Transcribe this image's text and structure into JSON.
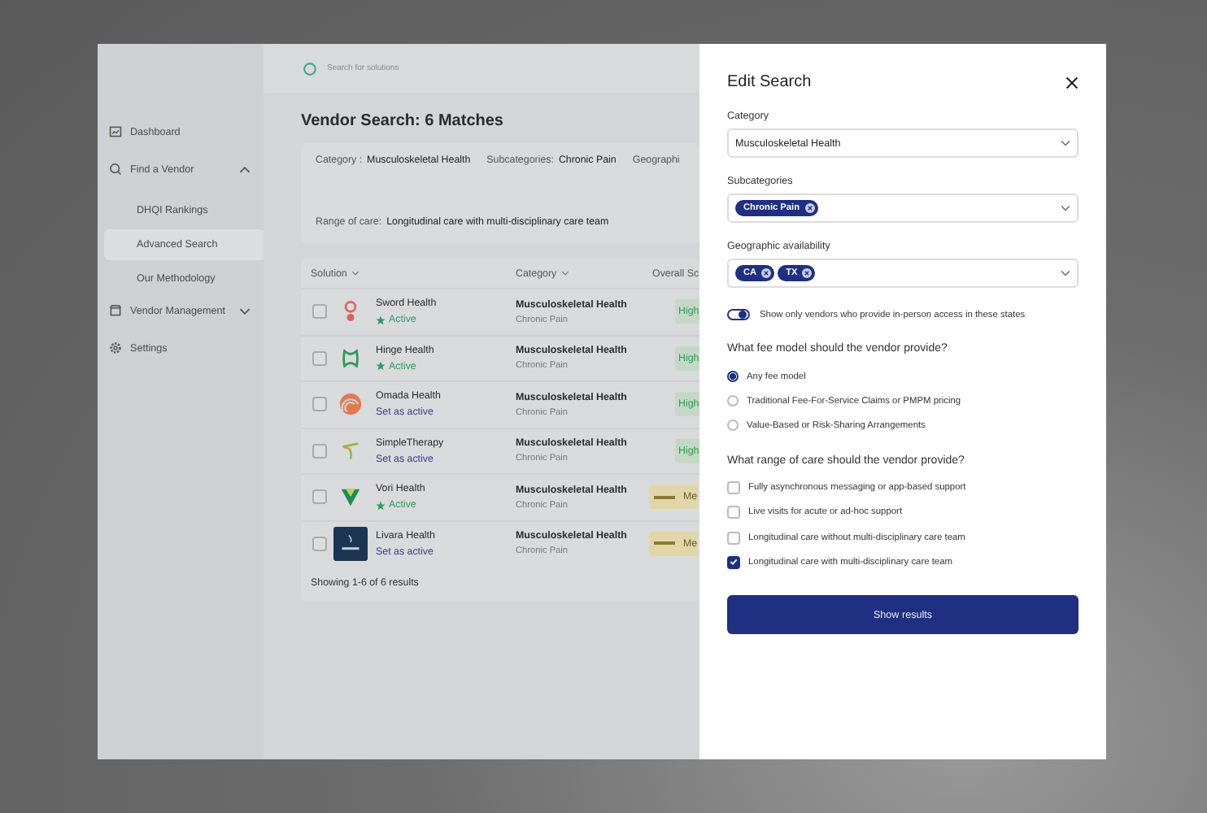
{
  "sidebar": {
    "items": [
      {
        "label": "Dashboard",
        "selected": false
      },
      {
        "label": "Find a Vendor",
        "expanded": true,
        "selected": false,
        "children": [
          {
            "label": "DHQI Rankings",
            "selected": false
          },
          {
            "label": "Advanced Search",
            "selected": true
          },
          {
            "label": "Our Methodology",
            "selected": false
          }
        ]
      },
      {
        "label": "Vendor Management",
        "expanded": false,
        "selected": false
      },
      {
        "label": "Settings",
        "selected": false
      }
    ]
  },
  "search": {
    "placeholder": "Search for solutions"
  },
  "page_title": "Vendor Search: 6 Matches",
  "filters": [
    {
      "label": "Category :",
      "value": "Musculoskeletal Health"
    },
    {
      "label": "Subcategories:",
      "value": "Chronic Pain"
    },
    {
      "label": "Geographi"
    }
  ],
  "range_filter": {
    "label": "Range of care:",
    "value": "Longitudinal care with multi-disciplinary care team"
  },
  "table": {
    "columns": [
      {
        "label": "Solution",
        "sortable": true
      },
      {
        "label": "Category",
        "sortable": true
      },
      {
        "label": "Overall Sc",
        "sortable": false
      }
    ],
    "rows": [
      {
        "name": "Sword Health",
        "status": "Active",
        "active": true,
        "checked": false,
        "category": "Musculoskeletal Health",
        "subcategory": "Chronic Pain",
        "score": {
          "text": "High",
          "kind": "high"
        }
      },
      {
        "name": "Hinge Health",
        "status": "Active",
        "active": true,
        "checked": false,
        "category": "Musculoskeletal Health",
        "subcategory": "Chronic Pain",
        "score": {
          "text": "High",
          "kind": "high"
        }
      },
      {
        "name": "Omada Health",
        "status": "Set as active",
        "active": false,
        "checked": false,
        "category": "Musculoskeletal Health",
        "subcategory": "Chronic Pain",
        "score": {
          "text": "High",
          "kind": "high"
        }
      },
      {
        "name": "SimpleTherapy",
        "status": "Set as active",
        "active": false,
        "checked": false,
        "category": "Musculoskeletal Health",
        "subcategory": "Chronic Pain",
        "score": {
          "text": "High",
          "kind": "high"
        }
      },
      {
        "name": "Vori Health",
        "status": "Active",
        "active": true,
        "checked": false,
        "category": "Musculoskeletal Health",
        "subcategory": "Chronic Pain",
        "score": {
          "text": "Me",
          "kind": "medium"
        }
      },
      {
        "name": "Livara Health",
        "status": "Set as active",
        "active": false,
        "checked": false,
        "category": "Musculoskeletal Health",
        "subcategory": "Chronic Pain",
        "score": {
          "text": "Me",
          "kind": "medium"
        }
      }
    ],
    "footer": "Showing 1-6 of 6 results"
  },
  "modal": {
    "title": "Edit Search",
    "category": {
      "label": "Category",
      "value": "Musculoskeletal Health"
    },
    "subcategories": {
      "label": "Subcategories",
      "chips": [
        "Chronic Pain"
      ]
    },
    "geography": {
      "label": "Geographic availability",
      "chips": [
        "CA",
        "TX"
      ]
    },
    "in_person_toggle": {
      "label": "Show only vendors who provide in-person access in these states",
      "on": true
    },
    "fee_question": "What fee model should the vendor provide?",
    "fee_options": [
      {
        "label": "Any fee model",
        "selected": true
      },
      {
        "label": "Traditional Fee-For-Service Claims or PMPM pricing",
        "selected": false
      },
      {
        "label": "Value-Based or Risk-Sharing Arrangements",
        "selected": false
      }
    ],
    "care_question": "What range of care should the vendor provide?",
    "care_options": [
      {
        "label": "Fully asynchronous messaging or app-based support",
        "checked": false
      },
      {
        "label": "Live visits for acute or ad-hoc support",
        "checked": false
      },
      {
        "label": "Longitudinal care without multi-disciplinary care team",
        "checked": false
      },
      {
        "label": "Longitudinal care with multi-disciplinary care team",
        "checked": true
      }
    ],
    "submit": "Show results"
  }
}
